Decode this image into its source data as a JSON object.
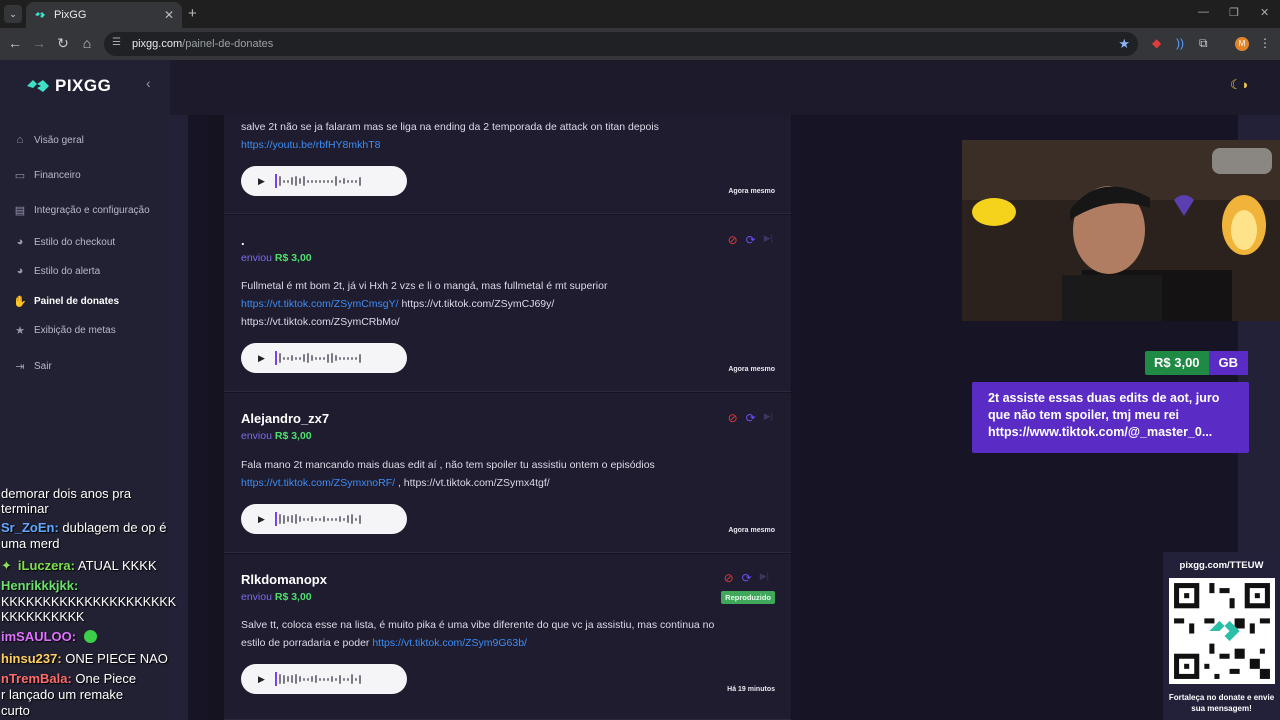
{
  "browser": {
    "tab_title": "PixGG",
    "url_domain": "pixgg.com",
    "url_path": "/painel-de-donates",
    "avatar_letter": "M"
  },
  "sidebar": {
    "logo": "PIXGG",
    "items": [
      {
        "label": "Visão geral",
        "icon": "home-icon"
      },
      {
        "label": "Financeiro",
        "icon": "wallet-icon"
      },
      {
        "label": "Integração e configuração",
        "icon": "settings-icon"
      },
      {
        "label": "Estilo do checkout",
        "icon": "palette-icon"
      },
      {
        "label": "Estilo do alerta",
        "icon": "palette-icon"
      },
      {
        "label": "Painel de donates",
        "icon": "hand-coin-icon"
      },
      {
        "label": "Exibição de metas",
        "icon": "star-icon"
      },
      {
        "label": "Sair",
        "icon": "logout-icon"
      }
    ]
  },
  "donations": [
    {
      "donor": "",
      "message_line1": "salve 2t não se ja falaram mas se liga na ending da 2 temporada de attack on titan depois",
      "link1": "https://youtu.be/rbfHY8mkhT8",
      "time": "Agora mesmo"
    },
    {
      "donor": ".",
      "sent_label": "enviou",
      "amount": "R$ 3,00",
      "message_line1": "Fullmetal é mt bom 2t, já vi Hxh 2 vzs e li o mangá, mas fullmetal é mt superior",
      "link1": "https://vt.tiktok.com/ZSymCmsgY/",
      "text2": " https://vt.tiktok.com/ZSymCJ69y/",
      "line3": "https://vt.tiktok.com/ZSymCRbMo/",
      "time": "Agora mesmo"
    },
    {
      "donor": "Alejandro_zx7",
      "sent_label": "enviou",
      "amount": "R$ 3,00",
      "message_line1": "Fala mano 2t mancando mais duas edit aí , não tem spoiler tu assistiu ontem o episódios",
      "link1": "https://vt.tiktok.com/ZSymxnoRF/",
      "text2": " , https://vt.tiktok.com/ZSymx4tgf/",
      "time": "Agora mesmo"
    },
    {
      "donor": "Rlkdomanopx",
      "sent_label": "enviou",
      "amount": "R$ 3,00",
      "badge": "Reproduzido",
      "message_line1": "Salve tt, coloca esse na lista, é muito pika é uma vibe diferente do que vc ja assistiu, mas continua no",
      "message_line2_prefix": "estilo de porradaria e poder ",
      "link1": "https://vt.tiktok.com/ZSym9G63b/",
      "time": "Há 19 minutos"
    }
  ],
  "alert": {
    "amount": "R$ 3,00",
    "name": "GB",
    "message": "2t assiste essas duas edits de aot, juro que não tem spoiler, tmj meu rei https://www.tiktok.com/@_master_0..."
  },
  "qr_panel": {
    "url": "pixgg.com/TTEUW",
    "cta": "Fortaleça no donate e envie sua mensagem!"
  },
  "chat": [
    {
      "user": "",
      "text": "demorar dois anos pra",
      "color": "#ffffff"
    },
    {
      "user": "",
      "text": "terminar",
      "color": "#ffffff"
    },
    {
      "user": "Sr_ZoEn:",
      "text": " dublagem de op é",
      "color": "#5fa8ff"
    },
    {
      "user": "",
      "text": "uma merd",
      "color": "#ffffff"
    },
    {
      "user": "iLuczera:",
      "text": " ATUAL KKKK",
      "color": "#7ee04b"
    },
    {
      "user": "Henrikkkjkk:",
      "text": "",
      "color": "#6be06b"
    },
    {
      "user": "",
      "text": "KKKKKKKKKKKKKKKKKKKKK",
      "color": "#ffffff"
    },
    {
      "user": "",
      "text": "KKKKKKKKKK",
      "color": "#ffffff"
    },
    {
      "user": "imSAULOO:",
      "text": "",
      "color": "#e070ff"
    },
    {
      "user": "hinsu237:",
      "text": " ONE PIECE NAO",
      "color": "#ffd060"
    },
    {
      "user": "nTremBala:",
      "text": " One Piece",
      "color": "#ff6b6b"
    },
    {
      "user": "",
      "text": "r lançado um remake",
      "color": "#ffffff"
    },
    {
      "user": "",
      "text": "curto",
      "color": "#ffffff"
    }
  ]
}
